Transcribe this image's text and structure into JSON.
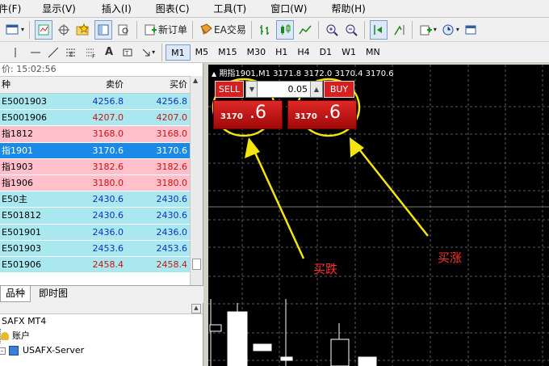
{
  "menu": {
    "items": [
      {
        "label": "件(F)"
      },
      {
        "label": "显示(V)"
      },
      {
        "label": "插入(I)"
      },
      {
        "label": "图表(C)"
      },
      {
        "label": "工具(T)"
      },
      {
        "label": "窗口(W)"
      },
      {
        "label": "帮助(H)"
      }
    ]
  },
  "toolbar": {
    "new_order": "新订单",
    "ea_trading": "EA交易"
  },
  "timeframes": [
    "M1",
    "M5",
    "M15",
    "M30",
    "H1",
    "H4",
    "D1",
    "W1",
    "MN"
  ],
  "market_watch": {
    "time_label": "价: 15:02:56",
    "col_symbol": "种",
    "col_bid": "卖价",
    "col_ask": "买价",
    "rows": [
      {
        "symbol": "E5001903",
        "bid": "4256.8",
        "ask": "4256.8",
        "style": "cyan",
        "color": "blue"
      },
      {
        "symbol": "E5001906",
        "bid": "4207.0",
        "ask": "4207.0",
        "style": "cyan",
        "color": "red"
      },
      {
        "symbol": "指1812",
        "bid": "3168.0",
        "ask": "3168.0",
        "style": "pink",
        "color": "red"
      },
      {
        "symbol": "指1901",
        "bid": "3170.6",
        "ask": "3170.6",
        "style": "sel",
        "color": "white"
      },
      {
        "symbol": "指1903",
        "bid": "3182.6",
        "ask": "3182.6",
        "style": "pink",
        "color": "red"
      },
      {
        "symbol": "指1906",
        "bid": "3180.0",
        "ask": "3180.0",
        "style": "pink",
        "color": "red"
      },
      {
        "symbol": "E50主",
        "bid": "2430.6",
        "ask": "2430.6",
        "style": "cyan",
        "color": "blue"
      },
      {
        "symbol": "E501812",
        "bid": "2430.6",
        "ask": "2430.6",
        "style": "cyan",
        "color": "blue"
      },
      {
        "symbol": "E501901",
        "bid": "2436.0",
        "ask": "2436.0",
        "style": "cyan",
        "color": "blue"
      },
      {
        "symbol": "E501903",
        "bid": "2453.6",
        "ask": "2453.6",
        "style": "cyan",
        "color": "blue"
      },
      {
        "symbol": "E501906",
        "bid": "2458.4",
        "ask": "2458.4",
        "style": "cyan",
        "color": "red"
      }
    ]
  },
  "tabs": [
    {
      "label": "品种"
    },
    {
      "label": "即时图"
    }
  ],
  "navigator": {
    "root": "SAFX MT4",
    "accounts": "账户",
    "server": "USAFX-Server"
  },
  "chart": {
    "title": "期指1901,M1  3171.8 3172.0 3170.4 3170.6",
    "sell_label": "SELL",
    "buy_label": "BUY",
    "lot": "0.05",
    "sell_price_small": "3170",
    "sell_price_big": ".6",
    "buy_price_small": "3170",
    "buy_price_big": ".6",
    "annot_sell": "买跌",
    "annot_buy": "买涨"
  },
  "colors": {
    "bid_blue": "#1030c0",
    "ask_red": "#d01010",
    "annotation_yellow": "#f4e60c",
    "annotation_text": "#ff3030"
  }
}
